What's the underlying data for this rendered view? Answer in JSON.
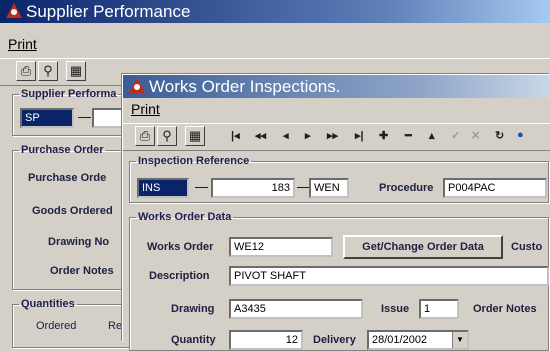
{
  "back_window": {
    "title": "Supplier Performance",
    "menu": "Print",
    "group_supplier": "Supplier Performa",
    "supplier_code": "SP",
    "group_purchase": "Purchase Order",
    "labels": [
      "Purchase Orde",
      "Goods Ordered",
      "Drawing No",
      "Order Notes"
    ],
    "group_quantities": "Quantities",
    "col_ordered": "Ordered",
    "col_re": "Re"
  },
  "front_window": {
    "title": "Works Order Inspections.",
    "menu": "Print",
    "inspection_reference": {
      "legend": "Inspection Reference",
      "prefix": "INS",
      "number": "183",
      "suffix": "WEN",
      "procedure_label": "Procedure",
      "procedure_value": "P004PAC"
    },
    "works_order": {
      "legend": "Works Order Data",
      "works_order_label": "Works Order",
      "works_order_value": "WE12",
      "get_change_button": "Get/Change Order Data",
      "customer_label": "Custo",
      "description_label": "Description",
      "description_value": "PIVOT SHAFT",
      "drawing_label": "Drawing",
      "drawing_value": "A3435",
      "issue_label": "Issue",
      "issue_value": "1",
      "order_notes_label": "Order Notes",
      "quantity_label": "Quantity",
      "quantity_value": "12",
      "delivery_label": "Delivery",
      "delivery_value": "28/01/2002"
    }
  }
}
